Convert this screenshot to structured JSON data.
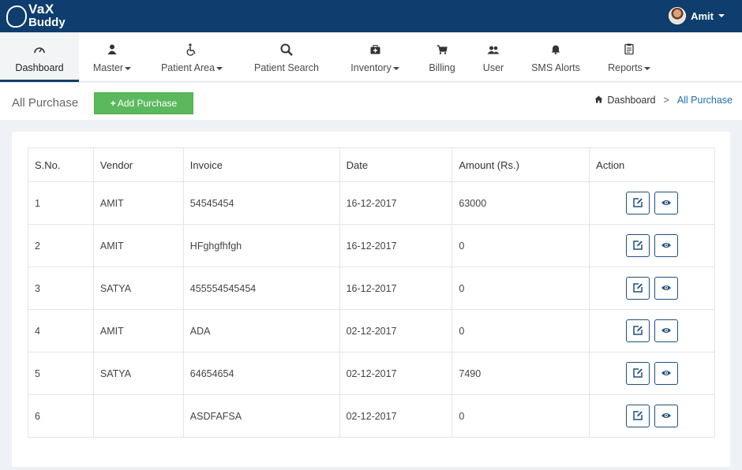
{
  "brand": {
    "line1": "VaX",
    "line2": "Buddy"
  },
  "user": {
    "name": "Amit"
  },
  "nav": [
    {
      "label": "Dashboard",
      "icon": "gauge-icon",
      "dropdown": false,
      "active": true
    },
    {
      "label": "Master",
      "icon": "user-icon",
      "dropdown": true,
      "active": false
    },
    {
      "label": "Patient Area",
      "icon": "wheelchair-icon",
      "dropdown": true,
      "active": false
    },
    {
      "label": "Patient Search",
      "icon": "search-icon",
      "dropdown": false,
      "active": false
    },
    {
      "label": "Inventory",
      "icon": "medkit-icon",
      "dropdown": true,
      "active": false
    },
    {
      "label": "Billing",
      "icon": "cart-icon",
      "dropdown": false,
      "active": false
    },
    {
      "label": "User",
      "icon": "users-icon",
      "dropdown": false,
      "active": false
    },
    {
      "label": "SMS Alorts",
      "icon": "bell-icon",
      "dropdown": false,
      "active": false
    },
    {
      "label": "Reports",
      "icon": "clipboard-icon",
      "dropdown": true,
      "active": false
    }
  ],
  "page": {
    "title": "All Purchase",
    "add_button": "Add Purchase",
    "breadcrumb": {
      "home": "Dashboard",
      "current": "All Purchase"
    }
  },
  "table": {
    "headers": [
      "S.No.",
      "Vendor",
      "Invoice",
      "Date",
      "Amount (Rs.)",
      "Action"
    ],
    "rows": [
      {
        "sno": "1",
        "vendor": "AMIT",
        "invoice": "54545454",
        "date": "16-12-2017",
        "amount": "63000"
      },
      {
        "sno": "2",
        "vendor": "AMIT",
        "invoice": "HFghgfhfgh",
        "date": "16-12-2017",
        "amount": "0"
      },
      {
        "sno": "3",
        "vendor": "SATYA",
        "invoice": "455554545454",
        "date": "16-12-2017",
        "amount": "0"
      },
      {
        "sno": "4",
        "vendor": "AMIT",
        "invoice": "ADA",
        "date": "02-12-2017",
        "amount": "0"
      },
      {
        "sno": "5",
        "vendor": "SATYA",
        "invoice": "64654654",
        "date": "02-12-2017",
        "amount": "7490"
      },
      {
        "sno": "6",
        "vendor": "",
        "invoice": "ASDFAFSA",
        "date": "02-12-2017",
        "amount": "0"
      }
    ],
    "actions": [
      "edit-icon",
      "view-icon"
    ]
  },
  "colors": {
    "topbar": "#0e3d6e",
    "add_button": "#5cb85c",
    "link": "#1f6fb2"
  }
}
